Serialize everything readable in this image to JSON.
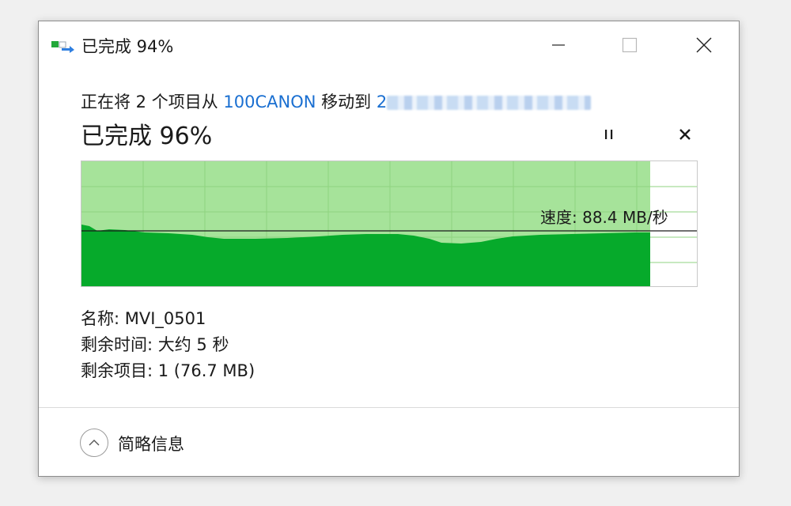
{
  "window": {
    "title": "已完成 94%"
  },
  "status": {
    "prefix": "正在将 2 个项目从 ",
    "source": "100CANON",
    "middle": " 移动到 ",
    "destination": "2"
  },
  "progress": {
    "label": "已完成 96%",
    "percent": 96
  },
  "graph": {
    "speed_label": "速度: 88.4 MB/秒",
    "colors": {
      "completed_area": "#a6e39a",
      "speed_fill": "#06aa2b",
      "grid": "#8fd380",
      "speed_line": "#1a1a1a"
    }
  },
  "details": {
    "name_label": "名称: MVI_0501",
    "time_label": "剩余时间: 大约 5 秒",
    "items_label": "剩余项目: 1 (76.7 MB)"
  },
  "footer": {
    "toggle_label": "简略信息"
  },
  "icons": {
    "title": "file-move-icon",
    "minimize": "minimize-icon",
    "maximize": "maximize-icon",
    "close": "close-icon",
    "pause": "pause-icon",
    "cancel": "cancel-icon",
    "toggle": "chevron-up-icon"
  }
}
